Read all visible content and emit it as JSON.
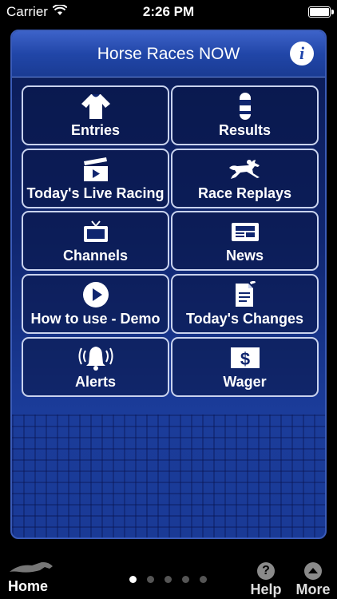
{
  "status_bar": {
    "carrier": "Carrier",
    "time": "2:26 PM"
  },
  "header": {
    "title": "Horse Races NOW",
    "info_label": "i"
  },
  "tiles": [
    {
      "label": "Entries",
      "icon": "jockey-silks-icon"
    },
    {
      "label": "Results",
      "icon": "finish-pole-icon"
    },
    {
      "label": "Today's Live Racing",
      "icon": "clapperboard-icon"
    },
    {
      "label": "Race Replays",
      "icon": "running-horse-icon"
    },
    {
      "label": "Channels",
      "icon": "tv-icon"
    },
    {
      "label": "News",
      "icon": "newspaper-icon"
    },
    {
      "label": "How to use - Demo",
      "icon": "play-icon"
    },
    {
      "label": "Today's Changes",
      "icon": "document-edit-icon"
    },
    {
      "label": "Alerts",
      "icon": "bell-icon"
    },
    {
      "label": "Wager",
      "icon": "dollar-icon"
    }
  ],
  "bottom_bar": {
    "home_label": "Home",
    "help_label": "Help",
    "help_icon_text": "?",
    "more_label": "More",
    "page_count": 5,
    "active_page": 1
  },
  "colors": {
    "panel": "#10266f",
    "header": "#2146a8",
    "tile_border": "#c9d3ee"
  }
}
